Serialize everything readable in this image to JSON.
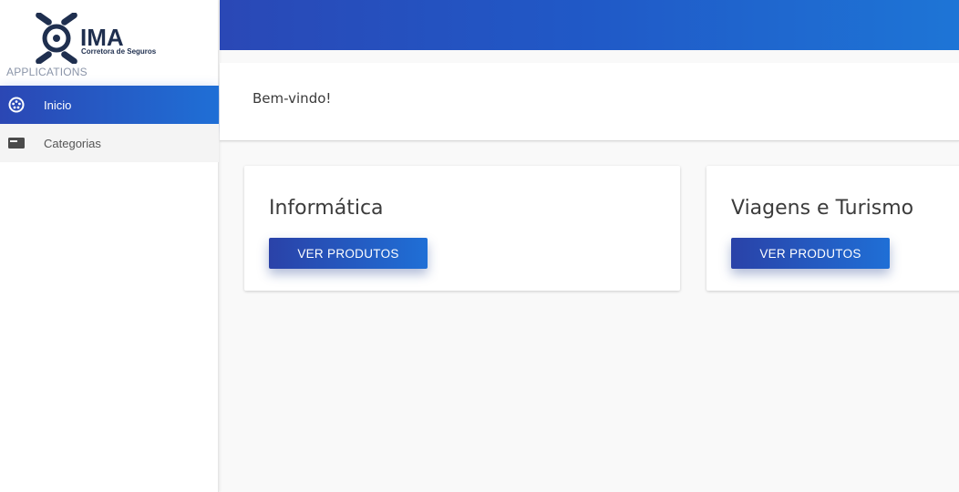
{
  "sidebar": {
    "logo": {
      "name": "IMA",
      "subtitle": "Corretora de Seguros"
    },
    "section_label": "APPLICATIONS",
    "items": [
      {
        "label": "Inicio",
        "icon": "dashboard-icon",
        "active": true
      },
      {
        "label": "Categorias",
        "icon": "category-icon",
        "active": false
      }
    ]
  },
  "main": {
    "welcome": "Bem-vindo!",
    "cards": [
      {
        "title": "Informática",
        "button": "VER PRODUTOS"
      },
      {
        "title": "Viagens e Turismo",
        "button": "VER PRODUTOS"
      }
    ]
  },
  "colors": {
    "primary": "#2a48b6",
    "primary_light": "#1e75d6",
    "logo_dark": "#1f2f4f"
  }
}
